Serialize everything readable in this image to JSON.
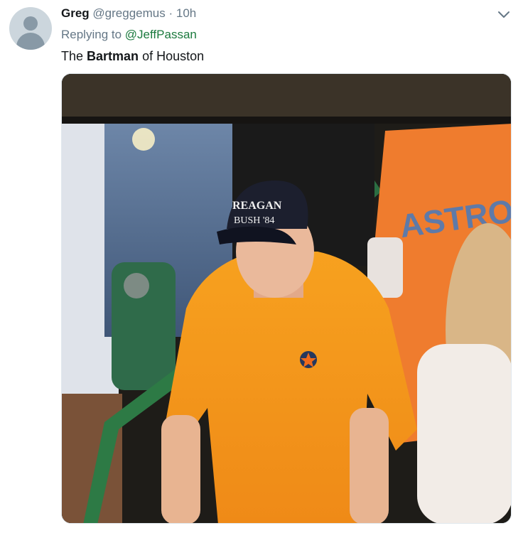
{
  "tweet": {
    "author_name": "Greg",
    "author_handle": "@greggemus",
    "separator": "·",
    "time": "10h",
    "replying_prefix": "Replying to",
    "replying_to": "@JeffPassan",
    "text_before": "The ",
    "text_bold": "Bartman",
    "text_after": " of Houston"
  },
  "media": {
    "hat_line1": "REAGAN",
    "hat_line2": "BUSH '84",
    "jersey_text": "ASTROS"
  },
  "icons": {
    "avatar": "default-avatar-icon",
    "menu": "chevron-down-icon"
  },
  "colors": {
    "link": "#1b7a3e",
    "muted": "#657786",
    "shirt": "#f0901c",
    "jersey": "#ef7c2e"
  }
}
